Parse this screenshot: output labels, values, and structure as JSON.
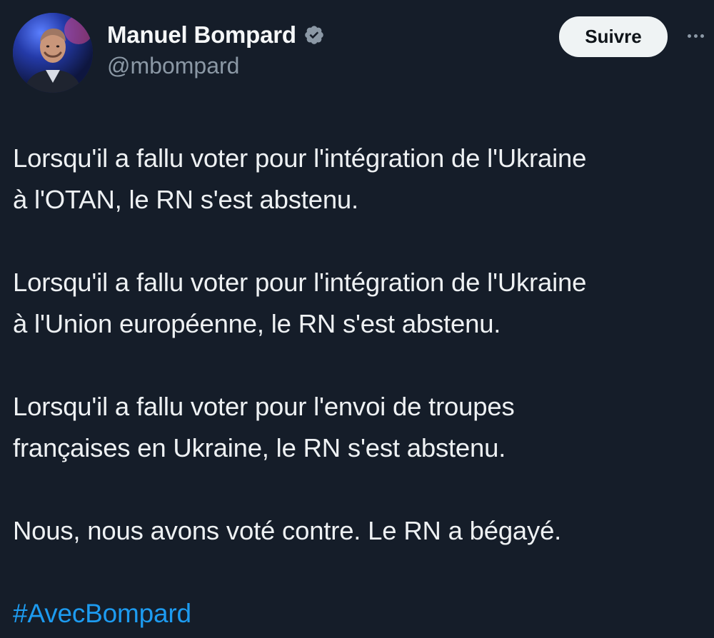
{
  "author": {
    "display_name": "Manuel Bompard",
    "handle": "@mbompard",
    "verified_icon": "verified-badge-icon",
    "avatar": "profile-avatar"
  },
  "actions": {
    "follow_label": "Suivre",
    "more_icon": "more-options-icon"
  },
  "tweet": {
    "paragraphs": [
      "Lorsqu'il a fallu voter pour l'intégration de l'Ukraine\nà l'OTAN, le RN s'est abstenu.",
      "Lorsqu'il a fallu voter pour l'intégration de l'Ukraine\nà l'Union européenne, le RN s'est abstenu.",
      "Lorsqu'il a fallu voter pour l'envoi de troupes\nfrançaises en Ukraine, le RN s'est abstenu.",
      "Nous, nous avons voté contre. Le RN a bégayé."
    ],
    "hashtag": "#AvecBompard"
  },
  "colors": {
    "background": "#151d29",
    "text": "#eef1f3",
    "secondary": "#8b98a5",
    "link": "#1d9bf0",
    "button_bg": "#eff3f4"
  }
}
